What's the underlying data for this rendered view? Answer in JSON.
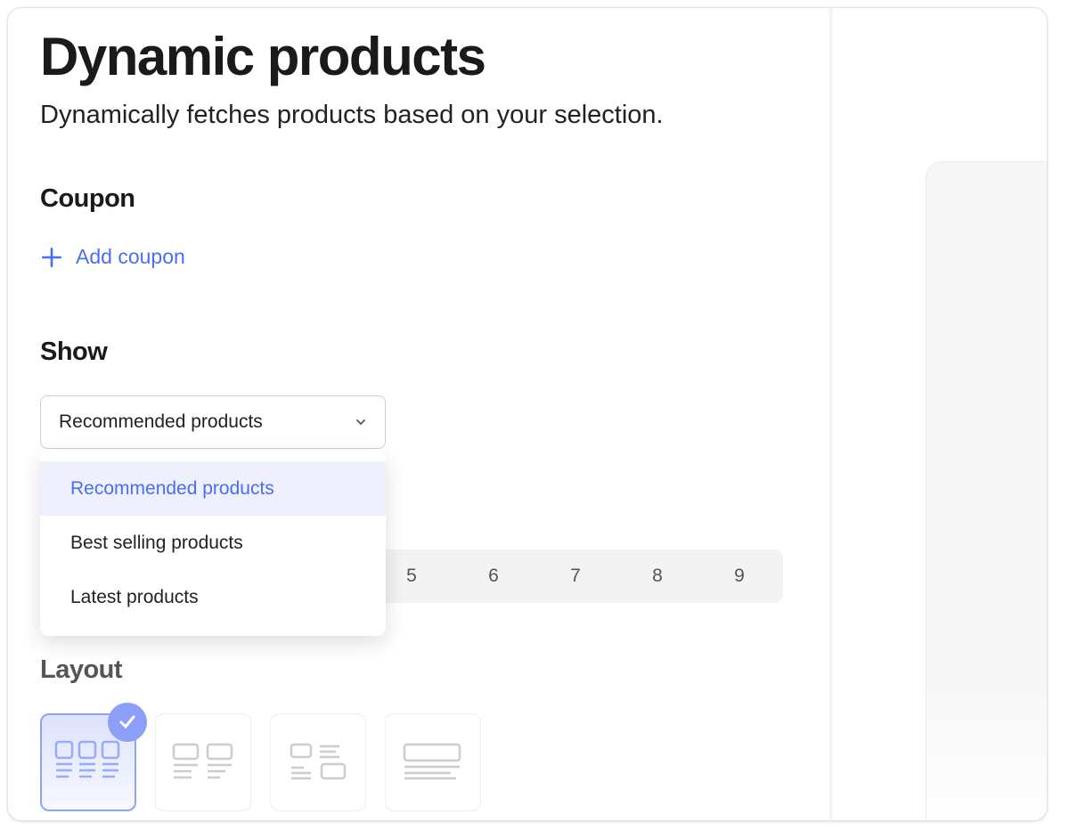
{
  "title": "Dynamic products",
  "subtitle": "Dynamically fetches products based on your selection.",
  "coupon": {
    "heading": "Coupon",
    "add_label": "Add coupon"
  },
  "show": {
    "heading": "Show",
    "selected": "Recommended products",
    "options": [
      "Recommended products",
      "Best selling products",
      "Latest products"
    ]
  },
  "count": {
    "visible_numbers": [
      "5",
      "6",
      "7",
      "8",
      "9"
    ]
  },
  "layout": {
    "heading": "Layout",
    "options": [
      "grid-3-column",
      "grid-2-column",
      "list-mixed",
      "single-wide"
    ],
    "selected": "grid-3-column"
  },
  "colors": {
    "accent": "#4a6cf7",
    "selected_bg": "#eef1fd"
  }
}
